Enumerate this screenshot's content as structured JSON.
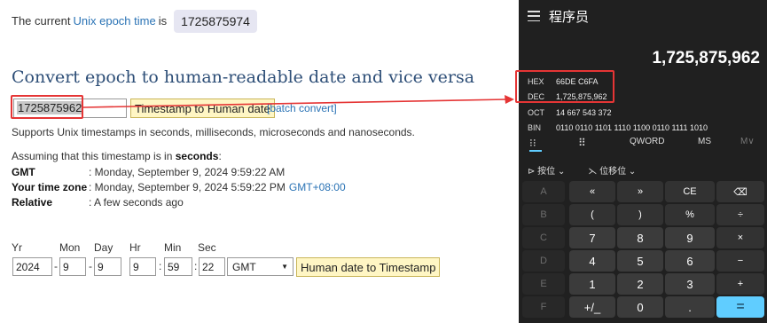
{
  "web": {
    "now_prefix": "The current",
    "now_link": "Unix epoch time",
    "now_suffix": "is",
    "now_value": "1725875974",
    "heading": "Convert epoch to human-readable date and vice versa",
    "timestamp_input": "1725875962",
    "to_human_button": "Timestamp to Human date",
    "batch_link": "[batch convert]",
    "support_text": "Supports Unix timestamps in seconds, milliseconds, microseconds and nanoseconds.",
    "assume_prefix": "Assuming that this timestamp is in",
    "assume_unit": "seconds",
    "assume_suffix": ":",
    "rows": [
      {
        "key": "GMT",
        "value": ": Monday, September 9, 2024 9:59:22 AM",
        "extra": ""
      },
      {
        "key": "Your time zone",
        "value": ": Monday, September 9, 2024 5:59:22 PM",
        "extra": "GMT+08:00"
      },
      {
        "key": "Relative",
        "value": ": A few seconds ago",
        "extra": ""
      }
    ],
    "date_labels": {
      "yr": "Yr",
      "mon": "Mon",
      "day": "Day",
      "hr": "Hr",
      "min": "Min",
      "sec": "Sec"
    },
    "date_values": {
      "yr": "2024",
      "mon": "9",
      "day": "9",
      "hr": "9",
      "min": "59",
      "sec": "22"
    },
    "separators": {
      "date": "-",
      "time": ":"
    },
    "tz_select": "GMT",
    "to_ts_button": "Human date to Timestamp"
  },
  "calc": {
    "title": "程序员",
    "display": "1,725,875,962",
    "bases": [
      {
        "key": "HEX",
        "value": "66DE C6FA"
      },
      {
        "key": "DEC",
        "value": "1,725,875,962"
      },
      {
        "key": "OCT",
        "value": "14 667 543 372"
      },
      {
        "key": "BIN",
        "value": "0110 0110 1101 1110 1100 0110 1111 1010"
      }
    ],
    "modes": {
      "word": "QWORD",
      "ms": "MS",
      "mv": "M∨"
    },
    "bitops": {
      "bitwise": "按位",
      "shift": "位移位"
    },
    "keys": [
      [
        "A",
        "«",
        "»",
        "CE",
        "⌫"
      ],
      [
        "B",
        "(",
        ")",
        "%",
        "÷"
      ],
      [
        "C",
        "7",
        "8",
        "9",
        "×"
      ],
      [
        "D",
        "4",
        "5",
        "6",
        "−"
      ],
      [
        "E",
        "1",
        "2",
        "3",
        "+"
      ],
      [
        "F",
        "+/_",
        "0",
        ".",
        "="
      ]
    ],
    "colors": {
      "bg": "#202020",
      "accent": "#60cdff",
      "highlight": "#e53535"
    }
  }
}
